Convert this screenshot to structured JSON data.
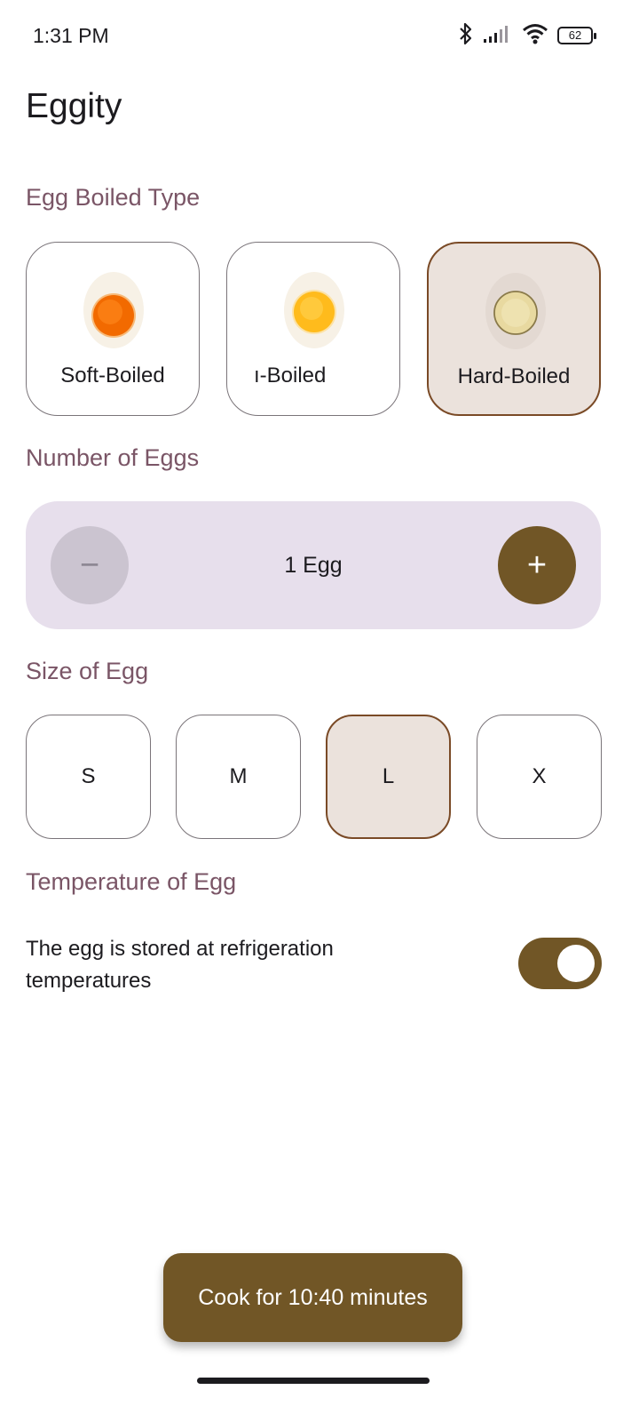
{
  "status_bar": {
    "time": "1:31 PM",
    "battery": "62",
    "icons": [
      "bluetooth-icon",
      "signal-icon",
      "wifi-icon",
      "battery-icon"
    ]
  },
  "app": {
    "title": "Eggity"
  },
  "boiled_type": {
    "title": "Egg Boiled Type",
    "options": [
      {
        "label": "Soft-Boiled",
        "yolk_color": "#f26a00",
        "selected": false
      },
      {
        "label": "ı-Boiled",
        "yolk_color": "#ffbb1c",
        "selected": false
      },
      {
        "label": "Hard-Boiled",
        "yolk_color": "#e8d9a0",
        "selected": true
      }
    ]
  },
  "number_of_eggs": {
    "title": "Number of Eggs",
    "value": "1 Egg",
    "minus_label": "−",
    "plus_label": "+"
  },
  "size_of_egg": {
    "title": "Size of Egg",
    "options": [
      {
        "label": "S",
        "selected": false
      },
      {
        "label": "M",
        "selected": false
      },
      {
        "label": "L",
        "selected": true
      },
      {
        "label": "X",
        "selected": false
      }
    ]
  },
  "temperature": {
    "title": "Temperature of Egg",
    "description": "The egg is stored at refrigeration temperatures",
    "toggle_on": true
  },
  "cook_button": {
    "label": "Cook for 10:40 minutes"
  },
  "colors": {
    "accent": "#715626",
    "section_title": "#7a5566",
    "selected_bg": "#ebe2dc",
    "counter_bg": "#e7dfec"
  }
}
